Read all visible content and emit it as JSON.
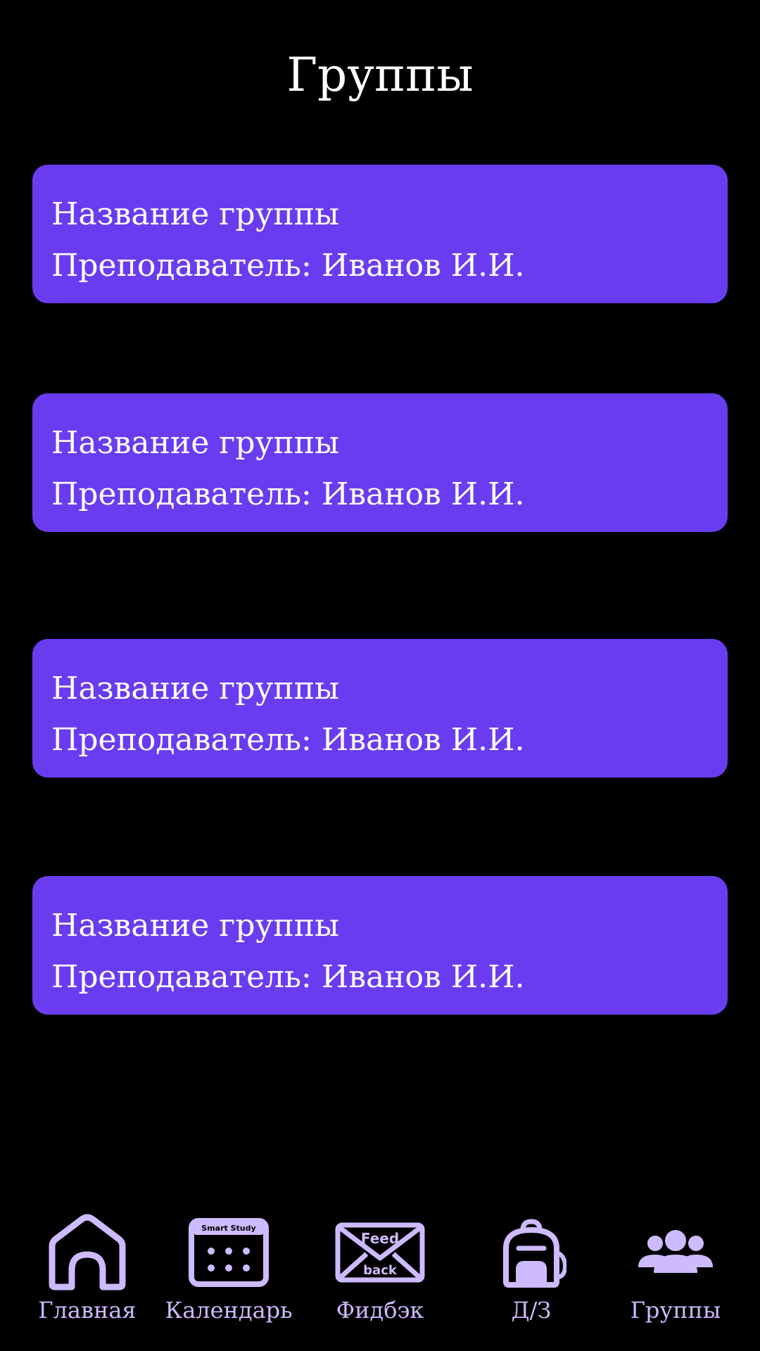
{
  "header": {
    "title": "Группы"
  },
  "groups": [
    {
      "name": "Название группы",
      "teacher": "Преподаватель: Иванов И.И."
    },
    {
      "name": "Название группы",
      "teacher": "Преподаватель: Иванов И.И."
    },
    {
      "name": "Название группы",
      "teacher": "Преподаватель: Иванов И.И."
    },
    {
      "name": "Название группы",
      "teacher": "Преподаватель: Иванов И.И."
    }
  ],
  "nav": {
    "items": [
      {
        "label": "Главная",
        "icon": "home-icon"
      },
      {
        "label": "Календарь",
        "icon": "calendar-icon",
        "icon_text": "Smart Study"
      },
      {
        "label": "Фидбэк",
        "icon": "feedback-envelope-icon",
        "icon_text_top": "Feed",
        "icon_text_bottom": "back"
      },
      {
        "label": "Д/З",
        "icon": "backpack-icon"
      },
      {
        "label": "Группы",
        "icon": "group-users-icon"
      }
    ]
  },
  "colors": {
    "background": "#000000",
    "card": "#6a3cf0",
    "text": "#ffffff",
    "nav_accent": "#cdbaff"
  }
}
